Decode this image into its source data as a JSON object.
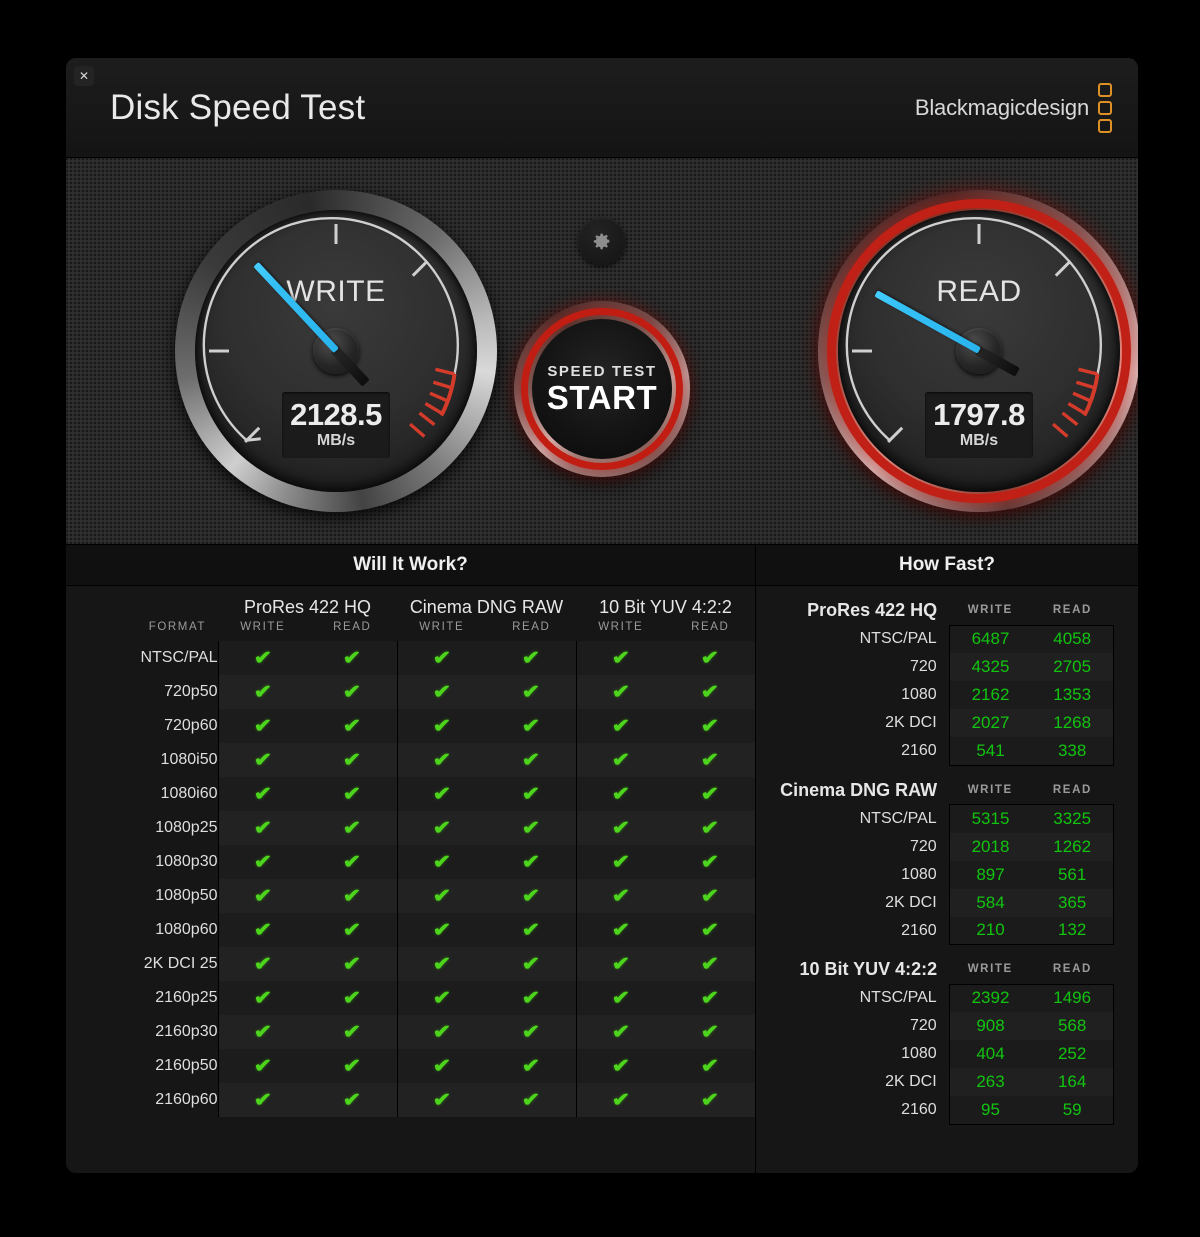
{
  "window": {
    "close_label": "✕",
    "title": "Disk Speed Test",
    "brand": "Blackmagicdesign"
  },
  "gauges": {
    "write": {
      "label": "WRITE",
      "value": "2128.5",
      "unit": "MB/s",
      "needle_deg": -133,
      "accent": "#35c0f5",
      "redline": "#c9281c",
      "glow": false
    },
    "read": {
      "label": "READ",
      "value": "1797.8",
      "unit": "MB/s",
      "needle_deg": -151,
      "accent": "#35c0f5",
      "redline": "#c9281c",
      "glow": true
    }
  },
  "controls": {
    "settings_icon": "gear-icon",
    "start_sub": "SPEED TEST",
    "start_main": "START"
  },
  "will_it_work": {
    "title": "Will It Work?",
    "format_header": "FORMAT",
    "codecs": [
      "ProRes 422 HQ",
      "Cinema DNG RAW",
      "10 Bit YUV 4:2:2"
    ],
    "sub_headers": [
      "WRITE",
      "READ"
    ],
    "tick_glyph": "✔",
    "tick_color": "#4dd41c",
    "rows": [
      {
        "format": "NTSC/PAL",
        "cells": [
          true,
          true,
          true,
          true,
          true,
          true
        ]
      },
      {
        "format": "720p50",
        "cells": [
          true,
          true,
          true,
          true,
          true,
          true
        ]
      },
      {
        "format": "720p60",
        "cells": [
          true,
          true,
          true,
          true,
          true,
          true
        ]
      },
      {
        "format": "1080i50",
        "cells": [
          true,
          true,
          true,
          true,
          true,
          true
        ]
      },
      {
        "format": "1080i60",
        "cells": [
          true,
          true,
          true,
          true,
          true,
          true
        ]
      },
      {
        "format": "1080p25",
        "cells": [
          true,
          true,
          true,
          true,
          true,
          true
        ]
      },
      {
        "format": "1080p30",
        "cells": [
          true,
          true,
          true,
          true,
          true,
          true
        ]
      },
      {
        "format": "1080p50",
        "cells": [
          true,
          true,
          true,
          true,
          true,
          true
        ]
      },
      {
        "format": "1080p60",
        "cells": [
          true,
          true,
          true,
          true,
          true,
          true
        ]
      },
      {
        "format": "2K DCI 25",
        "cells": [
          true,
          true,
          true,
          true,
          true,
          true
        ]
      },
      {
        "format": "2160p25",
        "cells": [
          true,
          true,
          true,
          true,
          true,
          true
        ]
      },
      {
        "format": "2160p30",
        "cells": [
          true,
          true,
          true,
          true,
          true,
          true
        ]
      },
      {
        "format": "2160p50",
        "cells": [
          true,
          true,
          true,
          true,
          true,
          true
        ]
      },
      {
        "format": "2160p60",
        "cells": [
          true,
          true,
          true,
          true,
          true,
          true
        ]
      }
    ]
  },
  "how_fast": {
    "title": "How Fast?",
    "sub_headers": [
      "WRITE",
      "READ"
    ],
    "value_color": "#12c40f",
    "groups": [
      {
        "name": "ProRes 422 HQ",
        "rows": [
          {
            "label": "NTSC/PAL",
            "write": "6487",
            "read": "4058"
          },
          {
            "label": "720",
            "write": "4325",
            "read": "2705"
          },
          {
            "label": "1080",
            "write": "2162",
            "read": "1353"
          },
          {
            "label": "2K DCI",
            "write": "2027",
            "read": "1268"
          },
          {
            "label": "2160",
            "write": "541",
            "read": "338"
          }
        ]
      },
      {
        "name": "Cinema DNG RAW",
        "rows": [
          {
            "label": "NTSC/PAL",
            "write": "5315",
            "read": "3325"
          },
          {
            "label": "720",
            "write": "2018",
            "read": "1262"
          },
          {
            "label": "1080",
            "write": "897",
            "read": "561"
          },
          {
            "label": "2K DCI",
            "write": "584",
            "read": "365"
          },
          {
            "label": "2160",
            "write": "210",
            "read": "132"
          }
        ]
      },
      {
        "name": "10 Bit YUV 4:2:2",
        "rows": [
          {
            "label": "NTSC/PAL",
            "write": "2392",
            "read": "1496"
          },
          {
            "label": "720",
            "write": "908",
            "read": "568"
          },
          {
            "label": "1080",
            "write": "404",
            "read": "252"
          },
          {
            "label": "2K DCI",
            "write": "263",
            "read": "164"
          },
          {
            "label": "2160",
            "write": "95",
            "read": "59"
          }
        ]
      }
    ]
  }
}
